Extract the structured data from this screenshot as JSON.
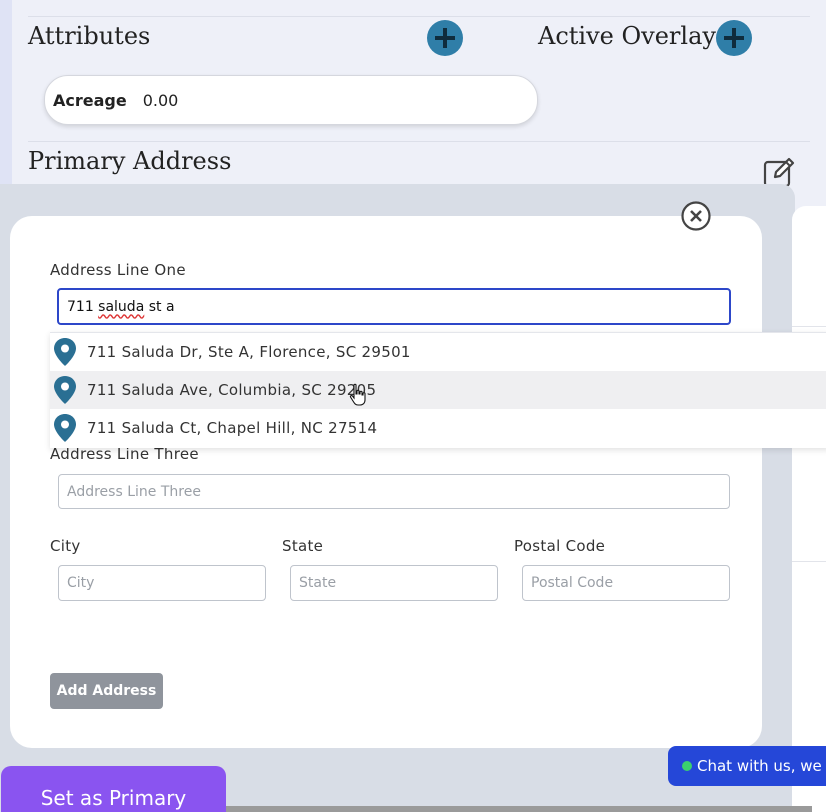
{
  "attributes_section": {
    "title": "Attributes",
    "pill": {
      "label": "Acreage",
      "value": "0.00"
    }
  },
  "overlays_section": {
    "title": "Active Overlays"
  },
  "address_section": {
    "title": "Primary Address"
  },
  "modal": {
    "address_line_one": {
      "label": "Address Line One",
      "value_part1": "711 ",
      "value_misspelled": "saluda",
      "value_part2": " st a"
    },
    "suggestions": [
      "711 Saluda Dr, Ste A, Florence, SC 29501",
      "711 Saluda Ave, Columbia, SC 29205",
      "711 Saluda Ct, Chapel Hill, NC 27514"
    ],
    "address_line_three": {
      "label": "Address Line Three",
      "placeholder": "Address Line Three"
    },
    "city": {
      "label": "City",
      "placeholder": "City"
    },
    "state": {
      "label": "State",
      "placeholder": "State"
    },
    "postal_code": {
      "label": "Postal Code",
      "placeholder": "Postal Code"
    },
    "add_button": "Add Address"
  },
  "set_primary_button": "Set as Primary",
  "chat_widget": {
    "label": "Chat with us, we are"
  },
  "colors": {
    "accent_blue": "#2f7ea8",
    "focus_border": "#2d47c9",
    "primary_purple": "#8a54f0",
    "chat_blue": "#2547d8",
    "status_green": "#3bd16f"
  }
}
